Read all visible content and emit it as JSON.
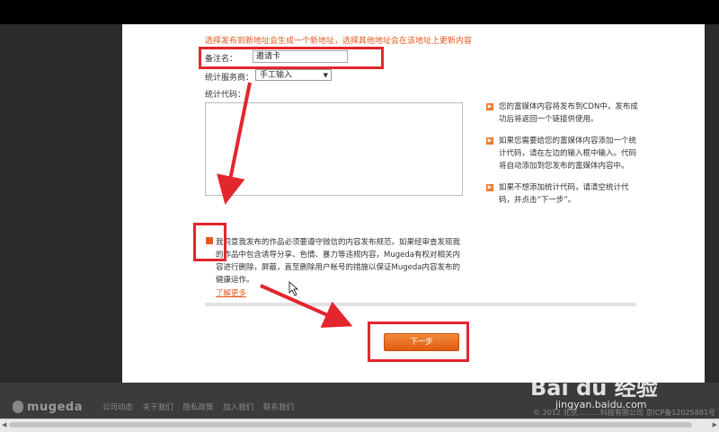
{
  "form": {
    "notice": "选择发布到新地址会生成一个新地址，选择其他地址会在该地址上更新内容",
    "remark_label": "备注名：",
    "remark_value": "邀请卡",
    "stat_provider_label": "统计服务商：",
    "stat_provider_value": "手工输入",
    "stat_code_label": "统计代码：",
    "agree_text": "我同意我发布的作品必须要遵守微信的内容发布规范。如果经审查发现我的作品中包含诱导分享、色情、暴力等违规内容，Mugeda有权对相关内容进行删除，屏蔽，直至删除用户帐号的措施以保证Mugeda内容发布的健康运作。",
    "learn_more": "了解更多",
    "next_button": "下一步"
  },
  "tips": [
    "您的富媒体内容将发布到CDN中，发布成功后将返回一个链接供使用。",
    "如果您需要给您的富媒体内容添加一个统计代码，请在左边的输入框中输入。代码将自动添加到您发布的富媒体内容中。",
    "如果不想添加统计代码，请清空统计代码，并点击“下一步”。"
  ],
  "footer": {
    "logo_text": "mugeda",
    "links": [
      "公司动态",
      "关于我们",
      "隐私政策",
      "加入我们",
      "联系我们"
    ],
    "copyright": "© 2012 北京..........科技有限公司 京ICP备12025881号"
  },
  "watermark": {
    "brand": "Bai du 经验",
    "url": "jingyan.baidu.com"
  },
  "colors": {
    "accent": "#e55a1f",
    "highlight": "#e3262d"
  }
}
